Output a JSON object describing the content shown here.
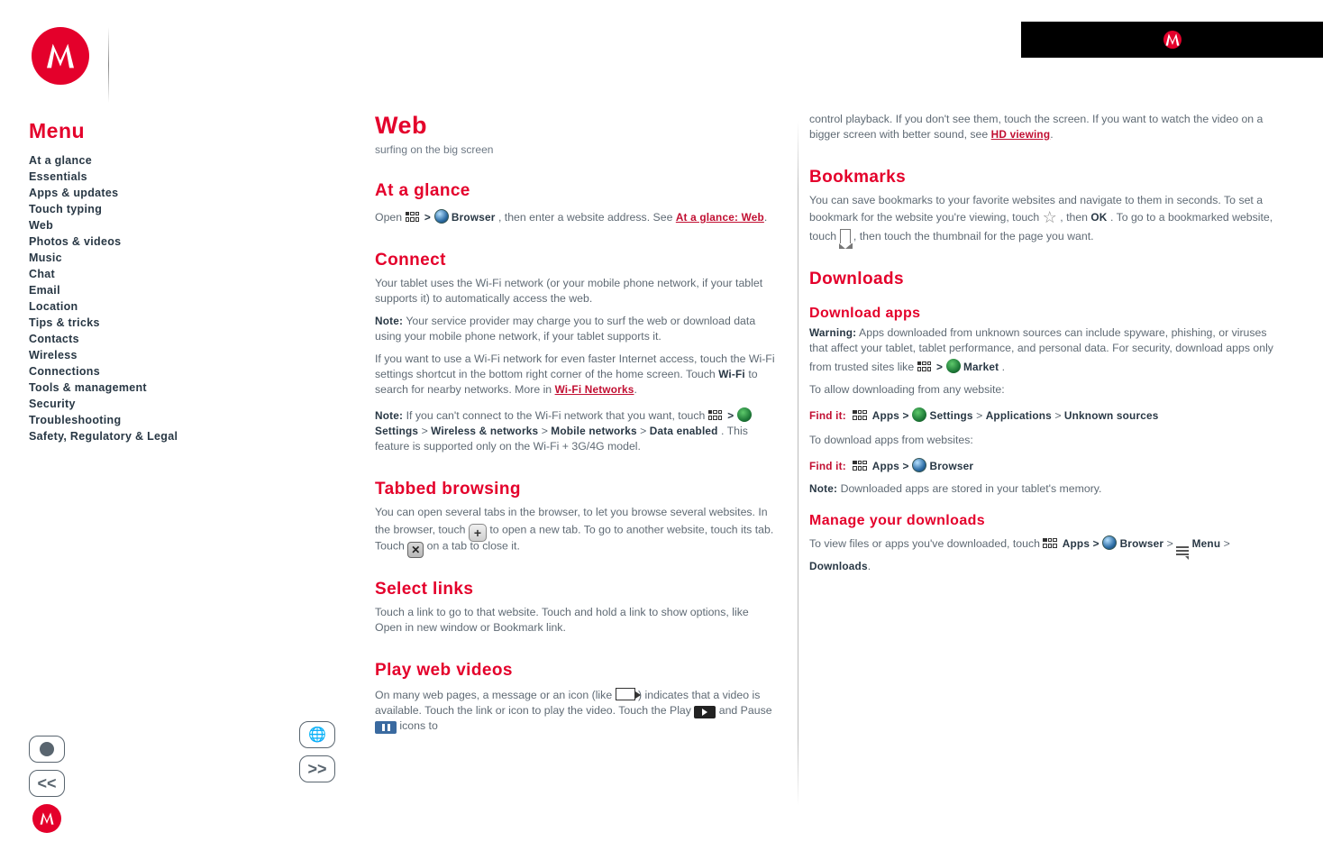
{
  "header": {},
  "menu": {
    "title": "Menu",
    "items": [
      "At a glance",
      "Essentials",
      "Apps & updates",
      "Touch typing",
      "Web",
      "Photos & videos",
      "Music",
      "Chat",
      "Email",
      "Location",
      "Tips & tricks",
      "Contacts",
      "Wireless",
      "Connections",
      "Tools & management",
      "Security",
      "Troubleshooting",
      "Safety, Regulatory & Legal"
    ]
  },
  "nav": {
    "back_label": "<<",
    "fwd_label": ">>"
  },
  "col1": {
    "title": "Web",
    "tagline": "surfing on the big screen",
    "at_a_glance": {
      "heading": "At a glance",
      "body1a": "Open ",
      "body1b": " > ",
      "browser_label": "Browser",
      "body1c": ", then enter a website address. See ",
      "link_text": "At a glance: Web",
      "body1d": "."
    },
    "connect": {
      "heading": "Connect",
      "body1": "Your tablet uses the Wi-Fi network (or your mobile phone network, if your tablet supports it) to automatically access the web.",
      "note_label": "Note:",
      "note_body": " Your service provider may charge you to surf the web or download data using your mobile phone network, if your tablet supports it.",
      "body2a": "If you want to use a Wi-Fi network for even faster Internet access, touch the Wi-Fi settings shortcut in the bottom right corner of the home screen. Touch ",
      "wifi_label": "Wi-Fi",
      "body2b": " to search for nearby networks. More in ",
      "wifi_link": "Wi-Fi Networks",
      "body2c": ".",
      "note2_label": "Note:",
      "note2_body": " If you can't connect to the Wi-Fi network that you want, touch ",
      "apps_label": " > ",
      "settings_label": "Settings",
      "gt": " > ",
      "wireless_label": "Wireless & networks",
      "gt2": " > ",
      "mobile_label": "Mobile networks",
      "gt3": " > ",
      "data_label": "Data enabled",
      "body2d": ". This feature is supported only on the Wi-Fi + 3G/4G model."
    },
    "tabbed": {
      "heading": "Tabbed browsing",
      "body1a": "You can open several tabs in the browser, to let you browse several websites. In the browser, touch ",
      "body1b": " to open a new tab. To go to another website, touch its tab. Touch ",
      "body1c": " on a tab to close it."
    },
    "select_links": {
      "heading": "Select links",
      "body": "Touch a link to go to that website. Touch and hold a link to show options, like Open in new window or Bookmark link."
    },
    "play_videos": {
      "heading": "Play web videos",
      "body1a": "On many web pages, a message or an icon (like ",
      "body1b": ") indicates that a video is available. Touch the link or icon to play the video. Touch the Play ",
      "body1c": " and Pause ",
      "body1d": " icons to"
    }
  },
  "col2": {
    "videos_continued": "control playback. If you don't see them, touch the screen. If you want to watch the video on a bigger screen with better sound, see ",
    "hd_viewing_link": "HD viewing",
    "videos_continued2": ".",
    "bookmarks": {
      "heading": "Bookmarks",
      "body1a": "You can save bookmarks to your favorite websites and navigate to them in seconds. To set a bookmark for the website you're viewing, touch ",
      "body1b": ", then ",
      "ok_label": "OK",
      "body1c": ". To go to a bookmarked website, touch ",
      "body1d": ", then touch the thumbnail for the page you want."
    },
    "downloads": {
      "heading": "Downloads",
      "apps_heading": "Download apps",
      "warning_label": "Warning:",
      "apps_body": " Apps downloaded from unknown sources can include spyware, phishing, or viruses that affect your tablet, tablet performance, and personal data. For security, download apps only from trusted sites like ",
      "market_label": "Market",
      "apps_body2": ".",
      "to_allow": "To allow downloading from any website:",
      "find_label": "Find it:",
      "find_apps": " Apps > ",
      "settings": "Settings",
      "gt": " > ",
      "apps_menu": "Applications",
      "gt2": " > ",
      "unk": "Unknown sources",
      "to_download": "To download apps from websites:",
      "find_label2": "Find it:",
      "apps2": " Apps > ",
      "browser": "Browser",
      "note_label": "Note:",
      "note_body": " Downloaded apps are stored in your tablet's memory.",
      "manage_heading": "Manage your downloads",
      "manage_body": "To view files or apps you've downloaded, touch ",
      "apps3": " Apps > ",
      "browser2": "Browser",
      "gt3": " > ",
      "menu_label": "Menu",
      "gt4": " > ",
      "dl_label": "Downloads",
      "period": "."
    }
  }
}
